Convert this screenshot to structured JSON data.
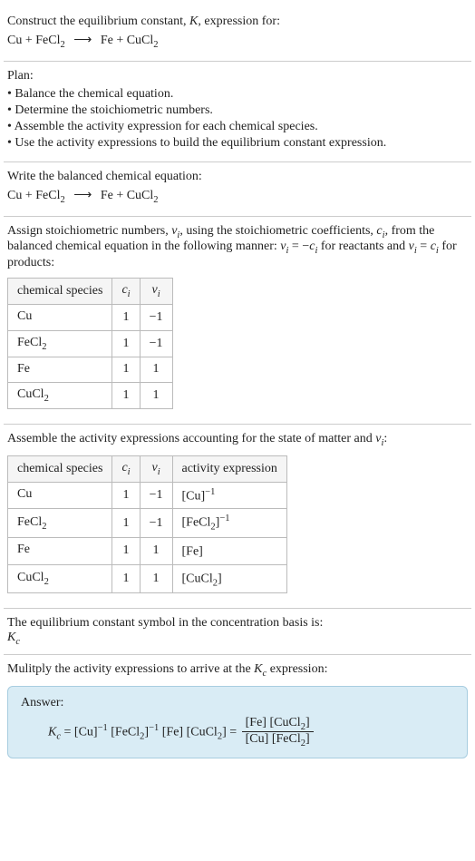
{
  "intro": {
    "prompt_line1": "Construct the equilibrium constant, ",
    "K": "K",
    "prompt_line1_cont": ", expression for:",
    "reaction_lhs1": "Cu",
    "plus": " + ",
    "reaction_lhs2_a": "FeCl",
    "reaction_lhs2_sub": "2",
    "arrow": "⟶",
    "reaction_rhs1": "Fe",
    "reaction_rhs2_a": "CuCl",
    "reaction_rhs2_sub": "2"
  },
  "plan": {
    "title": "Plan:",
    "items": [
      "Balance the chemical equation.",
      "Determine the stoichiometric numbers.",
      "Assemble the activity expression for each chemical species.",
      "Use the activity expressions to build the equilibrium constant expression."
    ]
  },
  "balanced": {
    "prompt": "Write the balanced chemical equation:"
  },
  "stoich": {
    "text1": "Assign stoichiometric numbers, ",
    "nu_i": "ν",
    "nu_i_sub": "i",
    "text2": ", using the stoichiometric coefficients, ",
    "c_i": "c",
    "c_i_sub": "i",
    "text3": ", from the balanced chemical equation in the following manner: ",
    "eq1_l": "ν",
    "eq1_lsub": "i",
    "eq1_mid": " = −",
    "eq1_r": "c",
    "eq1_rsub": "i",
    "text4": " for reactants and ",
    "eq2_l": "ν",
    "eq2_lsub": "i",
    "eq2_mid": " = ",
    "eq2_r": "c",
    "eq2_rsub": "i",
    "text5": " for products:",
    "table1": {
      "h1": "chemical species",
      "h2": "c",
      "h2_sub": "i",
      "h3": "ν",
      "h3_sub": "i",
      "rows": [
        {
          "sp": "Cu",
          "sp_sub": "",
          "c": "1",
          "nu": "−1"
        },
        {
          "sp": "FeCl",
          "sp_sub": "2",
          "c": "1",
          "nu": "−1"
        },
        {
          "sp": "Fe",
          "sp_sub": "",
          "c": "1",
          "nu": "1"
        },
        {
          "sp": "CuCl",
          "sp_sub": "2",
          "c": "1",
          "nu": "1"
        }
      ]
    }
  },
  "activity": {
    "text1": "Assemble the activity expressions accounting for the state of matter and ",
    "nu": "ν",
    "nu_sub": "i",
    "text2": ":",
    "table2": {
      "h1": "chemical species",
      "h2": "c",
      "h2_sub": "i",
      "h3": "ν",
      "h3_sub": "i",
      "h4": "activity expression",
      "rows": [
        {
          "sp": "Cu",
          "sp_sub": "",
          "c": "1",
          "nu": "−1",
          "ae": "[Cu]",
          "ae_sup": "−1"
        },
        {
          "sp": "FeCl",
          "sp_sub": "2",
          "c": "1",
          "nu": "−1",
          "ae_pre": "[FeCl",
          "ae_sub": "2",
          "ae_post": "]",
          "ae_sup": "−1"
        },
        {
          "sp": "Fe",
          "sp_sub": "",
          "c": "1",
          "nu": "1",
          "ae": "[Fe]",
          "ae_sup": ""
        },
        {
          "sp": "CuCl",
          "sp_sub": "2",
          "c": "1",
          "nu": "1",
          "ae_pre": "[CuCl",
          "ae_sub": "2",
          "ae_post": "]",
          "ae_sup": ""
        }
      ]
    }
  },
  "kc_symbol": {
    "text": "The equilibrium constant symbol in the concentration basis is:",
    "K": "K",
    "K_sub": "c"
  },
  "final": {
    "text1": "Mulitply the activity expressions to arrive at the ",
    "K": "K",
    "K_sub": "c",
    "text2": " expression:"
  },
  "answer": {
    "label": "Answer:",
    "Kc_K": "K",
    "Kc_sub": "c",
    "eq": " = ",
    "t1": "[Cu]",
    "t1_sup": "−1",
    "sp": " ",
    "t2_pre": "[FeCl",
    "t2_sub": "2",
    "t2_post": "]",
    "t2_sup": "−1",
    "t3": "[Fe]",
    "t4_pre": "[CuCl",
    "t4_sub": "2",
    "t4_post": "]",
    "eq2": " = ",
    "num1": "[Fe]",
    "num2_pre": "[CuCl",
    "num2_sub": "2",
    "num2_post": "]",
    "den1": "[Cu]",
    "den2_pre": "[FeCl",
    "den2_sub": "2",
    "den2_post": "]"
  },
  "chart_data": {
    "type": "table",
    "tables": [
      {
        "title": "Stoichiometric numbers",
        "columns": [
          "chemical species",
          "c_i",
          "ν_i"
        ],
        "rows": [
          [
            "Cu",
            1,
            -1
          ],
          [
            "FeCl2",
            1,
            -1
          ],
          [
            "Fe",
            1,
            1
          ],
          [
            "CuCl2",
            1,
            1
          ]
        ]
      },
      {
        "title": "Activity expressions",
        "columns": [
          "chemical species",
          "c_i",
          "ν_i",
          "activity expression"
        ],
        "rows": [
          [
            "Cu",
            1,
            -1,
            "[Cu]^-1"
          ],
          [
            "FeCl2",
            1,
            -1,
            "[FeCl2]^-1"
          ],
          [
            "Fe",
            1,
            1,
            "[Fe]"
          ],
          [
            "CuCl2",
            1,
            1,
            "[CuCl2]"
          ]
        ]
      }
    ]
  }
}
